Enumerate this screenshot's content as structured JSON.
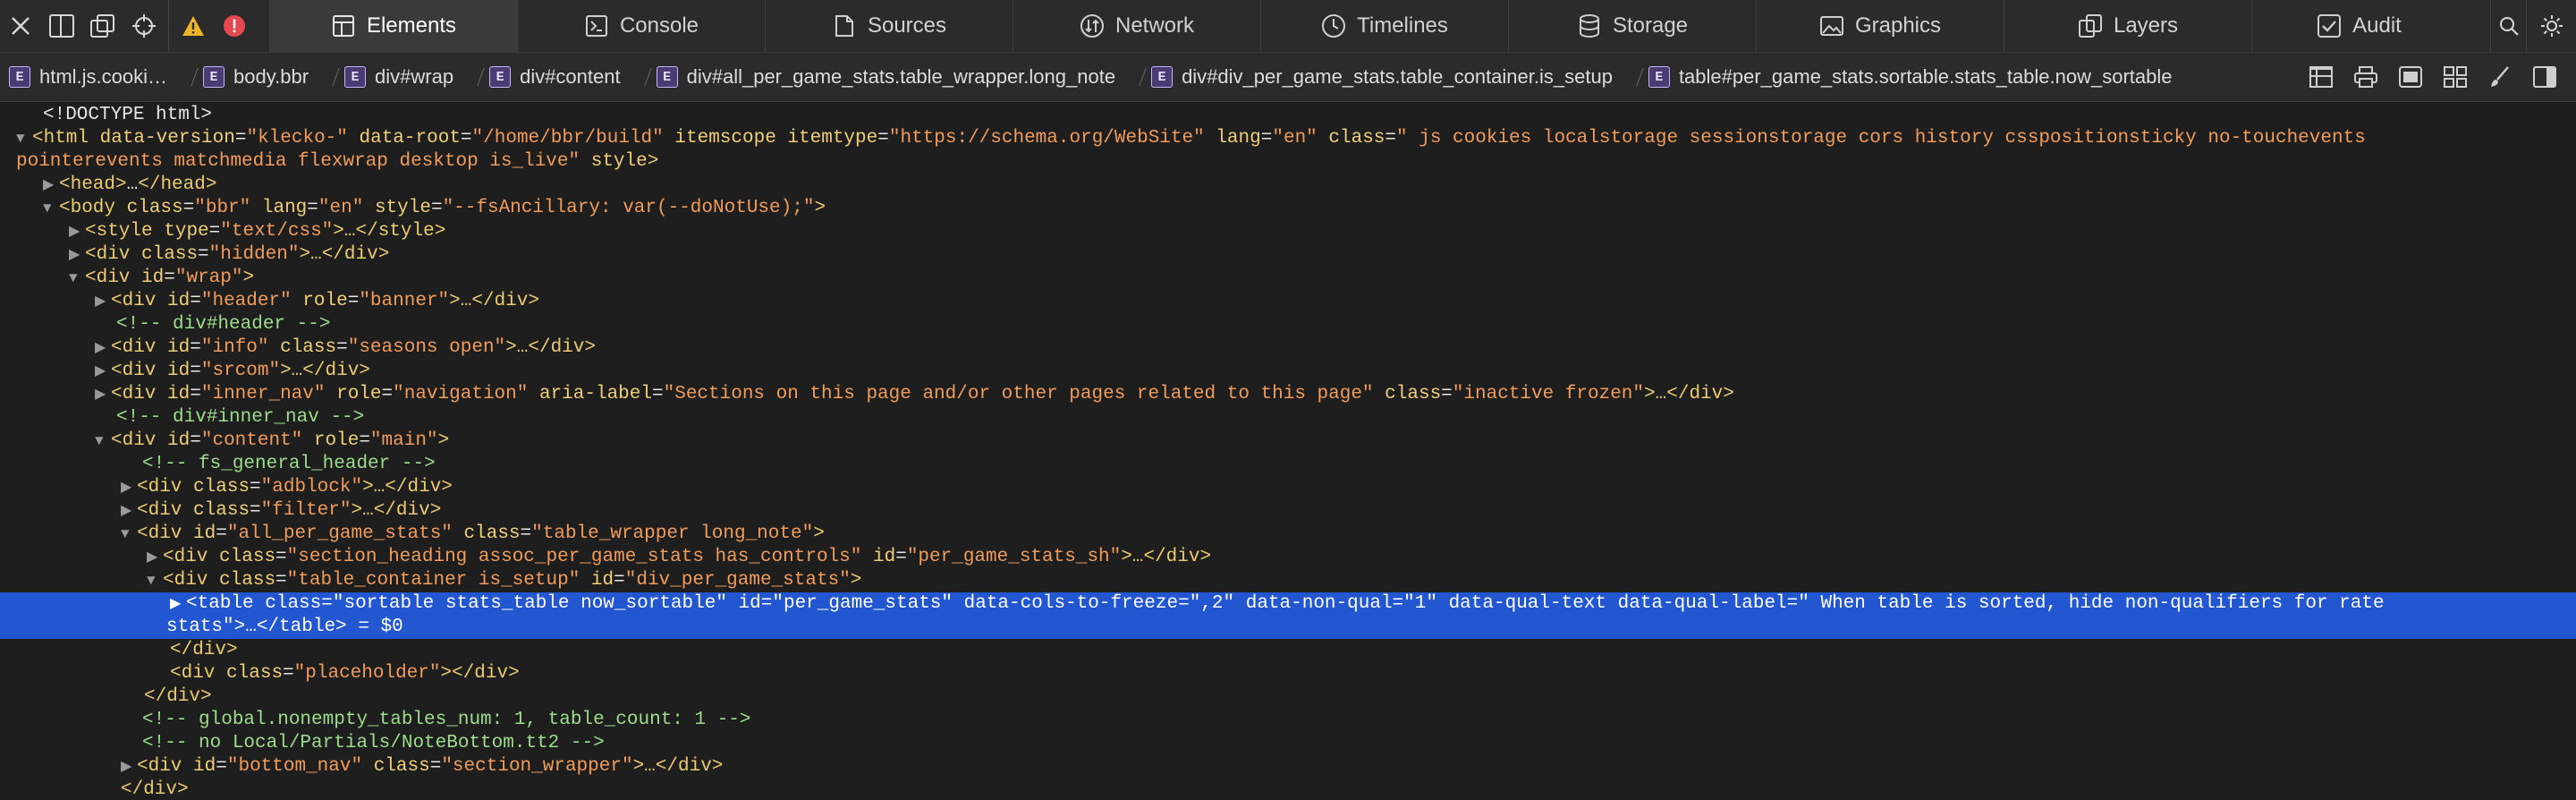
{
  "toolbar": {
    "tabs": [
      {
        "label": "Elements",
        "icon": "elements-icon",
        "active": true
      },
      {
        "label": "Console",
        "icon": "console-icon"
      },
      {
        "label": "Sources",
        "icon": "sources-icon"
      },
      {
        "label": "Network",
        "icon": "network-icon"
      },
      {
        "label": "Timelines",
        "icon": "timelines-icon"
      },
      {
        "label": "Storage",
        "icon": "storage-icon"
      },
      {
        "label": "Graphics",
        "icon": "graphics-icon"
      },
      {
        "label": "Layers",
        "icon": "layers-icon"
      },
      {
        "label": "Audit",
        "icon": "audit-icon"
      }
    ],
    "warning_color": "#f0b429",
    "error_color": "#e5484d",
    "accent": "#2357d1"
  },
  "breadcrumbs": [
    {
      "badge": "E",
      "label": "html.js.cooki…"
    },
    {
      "badge": "E",
      "label": "body.bbr"
    },
    {
      "badge": "E",
      "label": "div#wrap"
    },
    {
      "badge": "E",
      "label": "div#content"
    },
    {
      "badge": "E",
      "label": "div#all_per_game_stats.table_wrapper.long_note"
    },
    {
      "badge": "E",
      "label": "div#div_per_game_stats.table_container.is_setup"
    },
    {
      "badge": "E",
      "label": "table#per_game_stats.sortable.stats_table.now_sortable"
    }
  ],
  "dom": {
    "doctype": "<!DOCTYPE html>",
    "html_open": {
      "tag": "<html",
      "a1": "data-version",
      "v1": "\"klecko-\"",
      "a2": "data-root",
      "v2": "\"/home/bbr/build\"",
      "a3": "itemscope",
      "a4": "itemtype",
      "v4": "\"https://schema.org/WebSite\"",
      "a5": "lang",
      "v5": "\"en\"",
      "a6": "class",
      "v6": "\" js cookies localstorage sessionstorage cors history csspositionsticky no-touchevents",
      "v6b": "pointerevents matchmedia flexwrap desktop is_live\"",
      "a7": "style",
      "close": ">"
    },
    "head": {
      "open": "<head>",
      "ellipsis": "…",
      "close": "</head>"
    },
    "body_open": {
      "tag": "<body",
      "a1": "class",
      "v1": "\"bbr\"",
      "a2": "lang",
      "v2": "\"en\"",
      "a3": "style",
      "v3": "\"--fsAncillary: var(--doNotUse);\"",
      "close": ">"
    },
    "style": {
      "tag": "<style",
      "a1": "type",
      "v1": "\"text/css\"",
      "rest": ">…</style>"
    },
    "hidden": {
      "tag": "<div",
      "a1": "class",
      "v1": "\"hidden\"",
      "rest": ">…</div>"
    },
    "wrap": {
      "tag": "<div",
      "a1": "id",
      "v1": "\"wrap\"",
      "rest": ">"
    },
    "header": {
      "tag": "<div",
      "a1": "id",
      "v1": "\"header\"",
      "a2": "role",
      "v2": "\"banner\"",
      "rest": ">…</div>"
    },
    "c_header": "<!-- div#header -->",
    "info": {
      "tag": "<div",
      "a1": "id",
      "v1": "\"info\"",
      "a2": "class",
      "v2": "\"seasons open\"",
      "rest": ">…</div>"
    },
    "srcom": {
      "tag": "<div",
      "a1": "id",
      "v1": "\"srcom\"",
      "rest": ">…</div>"
    },
    "inner_nav": {
      "tag": "<div",
      "a1": "id",
      "v1": "\"inner_nav\"",
      "a2": "role",
      "v2": "\"navigation\"",
      "a3": "aria-label",
      "v3": "\"Sections on this page and/or other pages related to this page\"",
      "a4": "class",
      "v4": "\"inactive frozen\"",
      "rest": ">…</div>"
    },
    "c_inner_nav": "<!-- div#inner_nav -->",
    "content": {
      "tag": "<div",
      "a1": "id",
      "v1": "\"content\"",
      "a2": "role",
      "v2": "\"main\"",
      "rest": ">"
    },
    "c_fs": "<!-- fs_general_header -->",
    "adblock": {
      "tag": "<div",
      "a1": "class",
      "v1": "\"adblock\"",
      "rest": ">…</div>"
    },
    "filter": {
      "tag": "<div",
      "a1": "class",
      "v1": "\"filter\"",
      "rest": ">…</div>"
    },
    "all_pgs": {
      "tag": "<div",
      "a1": "id",
      "v1": "\"all_per_game_stats\"",
      "a2": "class",
      "v2": "\"table_wrapper long_note\"",
      "rest": ">"
    },
    "section_heading": {
      "tag": "<div",
      "a1": "class",
      "v1": "\"section_heading assoc_per_game_stats has_controls\"",
      "a2": "id",
      "v2": "\"per_game_stats_sh\"",
      "rest": ">…</div>"
    },
    "table_container": {
      "tag": "<div",
      "a1": "class",
      "v1": "\"table_container is_setup\"",
      "a2": "id",
      "v2": "\"div_per_game_stats\"",
      "rest": ">"
    },
    "table": {
      "tag": "<table",
      "a1": "class",
      "v1": "\"sortable stats_table now_sortable\"",
      "a2": "id",
      "v2": "\"per_game_stats\"",
      "a3": "data-cols-to-freeze",
      "v3": "\",2\"",
      "a4": "data-non-qual",
      "v4": "\"1\"",
      "a5": "data-qual-text",
      "a6": "data-qual-label",
      "v6": "\" When table is sorted, hide non-qualifiers for rate",
      "v6b": "stats\"",
      "rest": ">…</table>",
      "sel": " = $0"
    },
    "div_close1": "</div>",
    "placeholder": {
      "tag": "<div",
      "a1": "class",
      "v1": "\"placeholder\"",
      "rest": "></div>"
    },
    "div_close2": "</div>",
    "c_global": "<!-- global.nonempty_tables_num: 1, table_count: 1 -->",
    "c_note": "<!-- no Local/Partials/NoteBottom.tt2 -->",
    "bottom_nav": {
      "tag": "<div",
      "a1": "id",
      "v1": "\"bottom_nav\"",
      "a2": "class",
      "v2": "\"section_wrapper\"",
      "rest": ">…</div>"
    },
    "div_close3": "</div>"
  }
}
